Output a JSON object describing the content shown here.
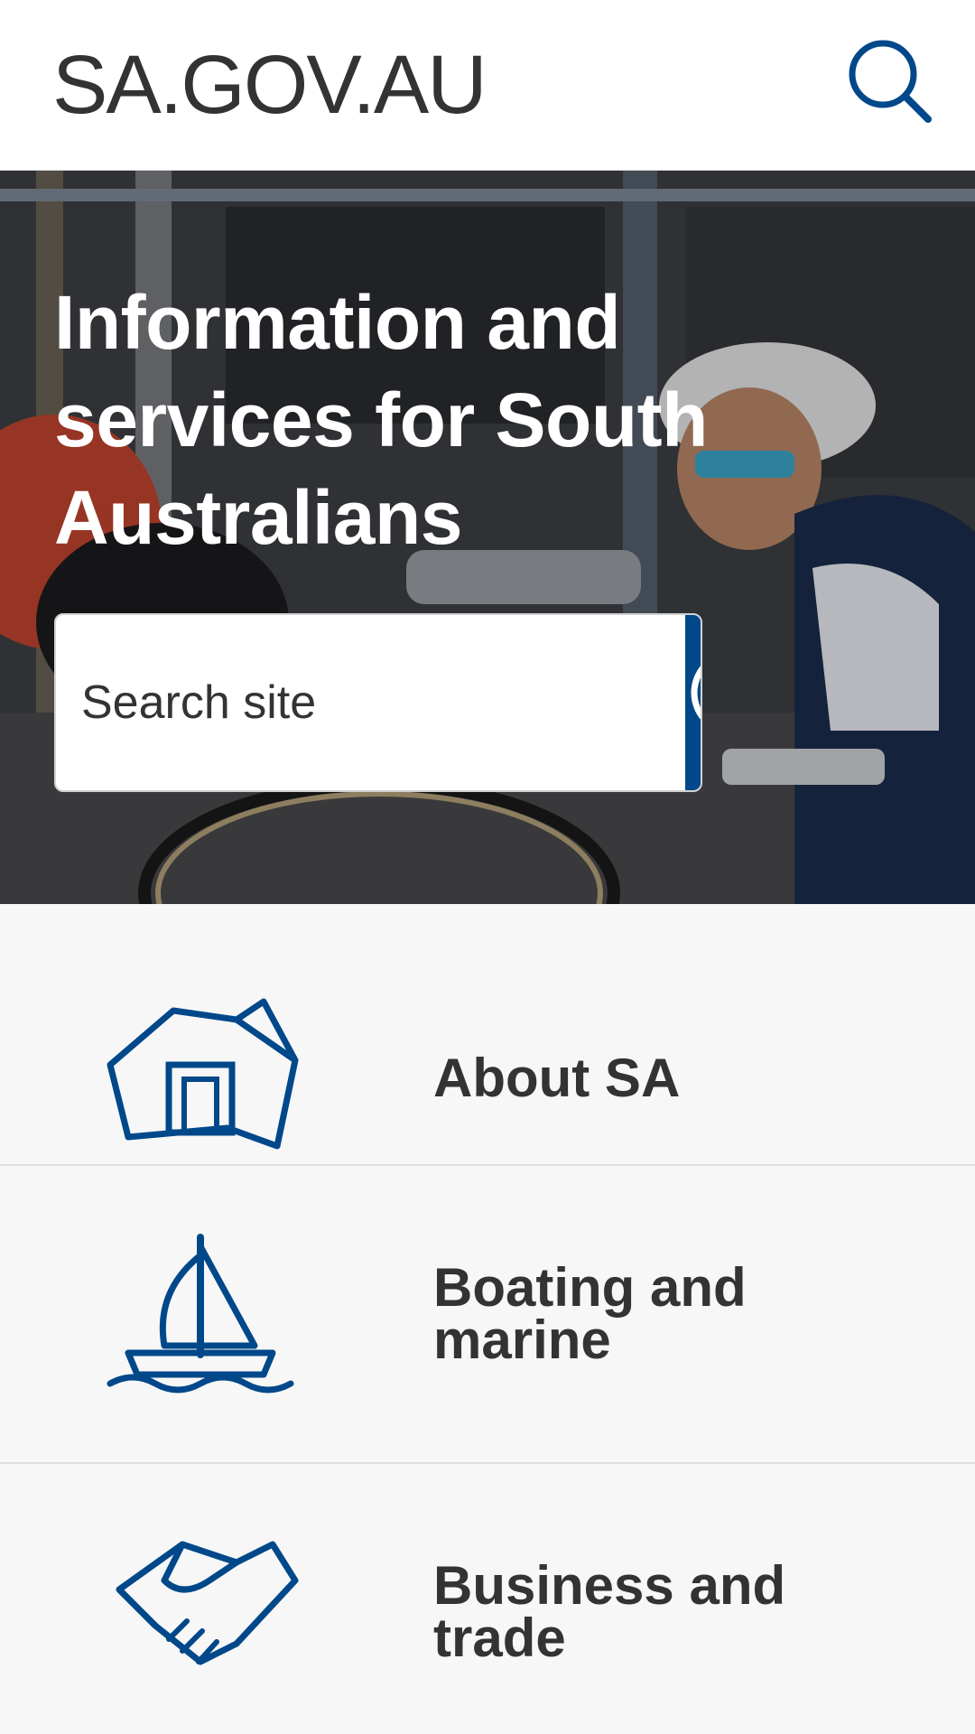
{
  "header": {
    "logo_text": "SA.GOV.AU",
    "search_icon": "search-icon"
  },
  "hero": {
    "title": "Information and services for South Australians",
    "search": {
      "placeholder": "Search site",
      "button_icon": "search-icon"
    }
  },
  "categories": [
    {
      "label": "About SA",
      "icon": "house-icon"
    },
    {
      "label": "Boating and marine",
      "icon": "sailboat-icon"
    },
    {
      "label": "Business and trade",
      "icon": "handshake-icon"
    }
  ],
  "colors": {
    "brand_blue": "#00488a",
    "text_dark": "#333333",
    "background": "#f7f7f7"
  }
}
